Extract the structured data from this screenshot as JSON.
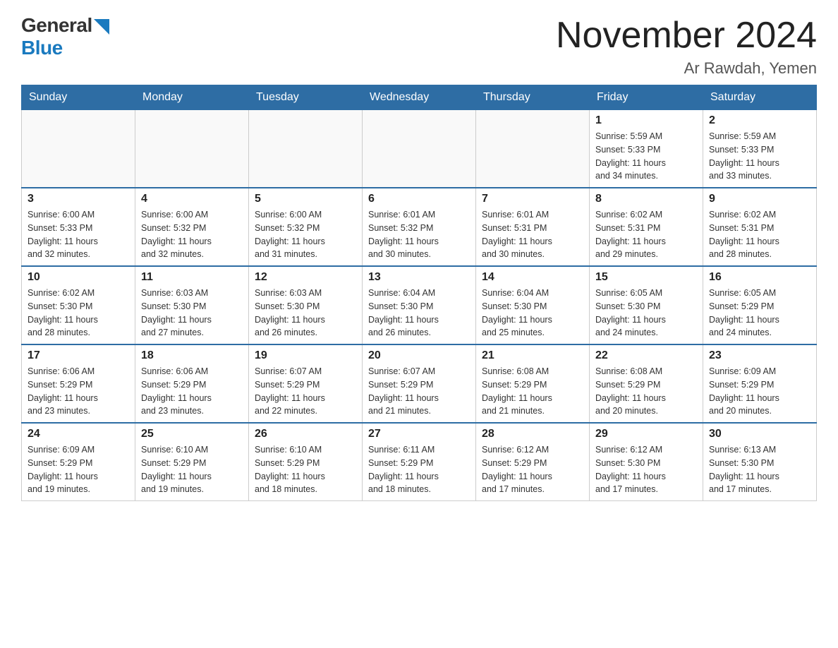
{
  "logo": {
    "general": "General",
    "blue": "Blue"
  },
  "title": "November 2024",
  "location": "Ar Rawdah, Yemen",
  "days_of_week": [
    "Sunday",
    "Monday",
    "Tuesday",
    "Wednesday",
    "Thursday",
    "Friday",
    "Saturday"
  ],
  "weeks": [
    [
      {
        "day": "",
        "info": ""
      },
      {
        "day": "",
        "info": ""
      },
      {
        "day": "",
        "info": ""
      },
      {
        "day": "",
        "info": ""
      },
      {
        "day": "",
        "info": ""
      },
      {
        "day": "1",
        "info": "Sunrise: 5:59 AM\nSunset: 5:33 PM\nDaylight: 11 hours\nand 34 minutes."
      },
      {
        "day": "2",
        "info": "Sunrise: 5:59 AM\nSunset: 5:33 PM\nDaylight: 11 hours\nand 33 minutes."
      }
    ],
    [
      {
        "day": "3",
        "info": "Sunrise: 6:00 AM\nSunset: 5:33 PM\nDaylight: 11 hours\nand 32 minutes."
      },
      {
        "day": "4",
        "info": "Sunrise: 6:00 AM\nSunset: 5:32 PM\nDaylight: 11 hours\nand 32 minutes."
      },
      {
        "day": "5",
        "info": "Sunrise: 6:00 AM\nSunset: 5:32 PM\nDaylight: 11 hours\nand 31 minutes."
      },
      {
        "day": "6",
        "info": "Sunrise: 6:01 AM\nSunset: 5:32 PM\nDaylight: 11 hours\nand 30 minutes."
      },
      {
        "day": "7",
        "info": "Sunrise: 6:01 AM\nSunset: 5:31 PM\nDaylight: 11 hours\nand 30 minutes."
      },
      {
        "day": "8",
        "info": "Sunrise: 6:02 AM\nSunset: 5:31 PM\nDaylight: 11 hours\nand 29 minutes."
      },
      {
        "day": "9",
        "info": "Sunrise: 6:02 AM\nSunset: 5:31 PM\nDaylight: 11 hours\nand 28 minutes."
      }
    ],
    [
      {
        "day": "10",
        "info": "Sunrise: 6:02 AM\nSunset: 5:30 PM\nDaylight: 11 hours\nand 28 minutes."
      },
      {
        "day": "11",
        "info": "Sunrise: 6:03 AM\nSunset: 5:30 PM\nDaylight: 11 hours\nand 27 minutes."
      },
      {
        "day": "12",
        "info": "Sunrise: 6:03 AM\nSunset: 5:30 PM\nDaylight: 11 hours\nand 26 minutes."
      },
      {
        "day": "13",
        "info": "Sunrise: 6:04 AM\nSunset: 5:30 PM\nDaylight: 11 hours\nand 26 minutes."
      },
      {
        "day": "14",
        "info": "Sunrise: 6:04 AM\nSunset: 5:30 PM\nDaylight: 11 hours\nand 25 minutes."
      },
      {
        "day": "15",
        "info": "Sunrise: 6:05 AM\nSunset: 5:30 PM\nDaylight: 11 hours\nand 24 minutes."
      },
      {
        "day": "16",
        "info": "Sunrise: 6:05 AM\nSunset: 5:29 PM\nDaylight: 11 hours\nand 24 minutes."
      }
    ],
    [
      {
        "day": "17",
        "info": "Sunrise: 6:06 AM\nSunset: 5:29 PM\nDaylight: 11 hours\nand 23 minutes."
      },
      {
        "day": "18",
        "info": "Sunrise: 6:06 AM\nSunset: 5:29 PM\nDaylight: 11 hours\nand 23 minutes."
      },
      {
        "day": "19",
        "info": "Sunrise: 6:07 AM\nSunset: 5:29 PM\nDaylight: 11 hours\nand 22 minutes."
      },
      {
        "day": "20",
        "info": "Sunrise: 6:07 AM\nSunset: 5:29 PM\nDaylight: 11 hours\nand 21 minutes."
      },
      {
        "day": "21",
        "info": "Sunrise: 6:08 AM\nSunset: 5:29 PM\nDaylight: 11 hours\nand 21 minutes."
      },
      {
        "day": "22",
        "info": "Sunrise: 6:08 AM\nSunset: 5:29 PM\nDaylight: 11 hours\nand 20 minutes."
      },
      {
        "day": "23",
        "info": "Sunrise: 6:09 AM\nSunset: 5:29 PM\nDaylight: 11 hours\nand 20 minutes."
      }
    ],
    [
      {
        "day": "24",
        "info": "Sunrise: 6:09 AM\nSunset: 5:29 PM\nDaylight: 11 hours\nand 19 minutes."
      },
      {
        "day": "25",
        "info": "Sunrise: 6:10 AM\nSunset: 5:29 PM\nDaylight: 11 hours\nand 19 minutes."
      },
      {
        "day": "26",
        "info": "Sunrise: 6:10 AM\nSunset: 5:29 PM\nDaylight: 11 hours\nand 18 minutes."
      },
      {
        "day": "27",
        "info": "Sunrise: 6:11 AM\nSunset: 5:29 PM\nDaylight: 11 hours\nand 18 minutes."
      },
      {
        "day": "28",
        "info": "Sunrise: 6:12 AM\nSunset: 5:29 PM\nDaylight: 11 hours\nand 17 minutes."
      },
      {
        "day": "29",
        "info": "Sunrise: 6:12 AM\nSunset: 5:30 PM\nDaylight: 11 hours\nand 17 minutes."
      },
      {
        "day": "30",
        "info": "Sunrise: 6:13 AM\nSunset: 5:30 PM\nDaylight: 11 hours\nand 17 minutes."
      }
    ]
  ]
}
